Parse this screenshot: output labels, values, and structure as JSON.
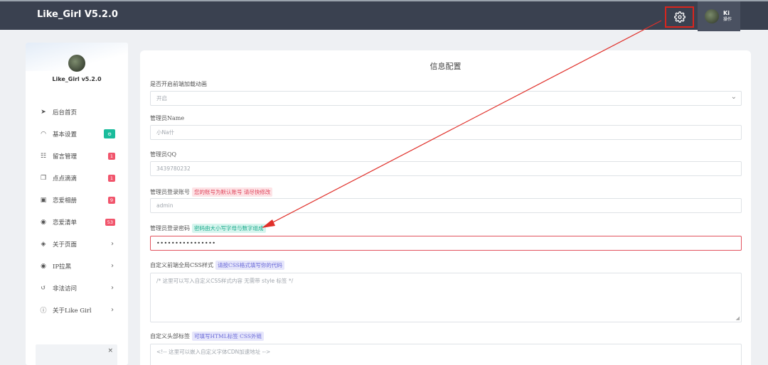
{
  "app": {
    "title": "Like_Girl V5.2.0"
  },
  "user": {
    "name": "Ki",
    "role": "操作"
  },
  "sidebar": {
    "title": "Like_Girl v5.2.0",
    "items": [
      {
        "label": "后台首页",
        "icon": "➤"
      },
      {
        "label": "基本设置",
        "icon": "◠",
        "badge": "⚙"
      },
      {
        "label": "留言管理",
        "icon": "☷",
        "badge": "1"
      },
      {
        "label": "点点滴滴",
        "icon": "❐",
        "badge": "1"
      },
      {
        "label": "恋爱相册",
        "icon": "▣",
        "badge": "9"
      },
      {
        "label": "恋爱清单",
        "icon": "◉",
        "badge": "53"
      },
      {
        "label": "关于页面",
        "icon": "◈",
        "chevron": "›"
      },
      {
        "label": "IP拉黑",
        "icon": "◉",
        "chevron": "›"
      },
      {
        "label": "非法访问",
        "icon": "↺",
        "chevron": "›"
      },
      {
        "label": "关于Like Girl",
        "icon": "ⓘ",
        "chevron": "›"
      }
    ],
    "card_close": "×"
  },
  "form": {
    "title": "信息配置",
    "animation": {
      "label": "是否开启前端加载动画",
      "value": "开启"
    },
    "admin_name": {
      "label": "管理员Name",
      "value": "小Na什"
    },
    "admin_qq": {
      "label": "管理员QQ",
      "value": "3439780232"
    },
    "admin_account": {
      "label": "管理员登录账号",
      "tag": "您的账号为默认账号 请尽快修改",
      "value": "admin"
    },
    "admin_password": {
      "label": "管理员登录密码",
      "tag": "密码由大小写字母与数字组成",
      "value": "••••••••••••••••"
    },
    "custom_css": {
      "label": "自定义前端全局CSS样式",
      "tag": "请按CSS格式填写你的代码",
      "placeholder": "/* 这里可以写入自定义CSS样式内容 无需带 style 标签 */"
    },
    "custom_head": {
      "label": "自定义头部标签",
      "tag": "可填写HTML标签 CSS外链",
      "placeholder": "<!-- 这里可以嵌入自定义字体CDN加速地址 -->"
    }
  },
  "colors": {
    "topbar": "#3a4150",
    "highlight": "#d9251d",
    "badge_red": "#f1556c",
    "badge_green": "#1abc9c"
  }
}
